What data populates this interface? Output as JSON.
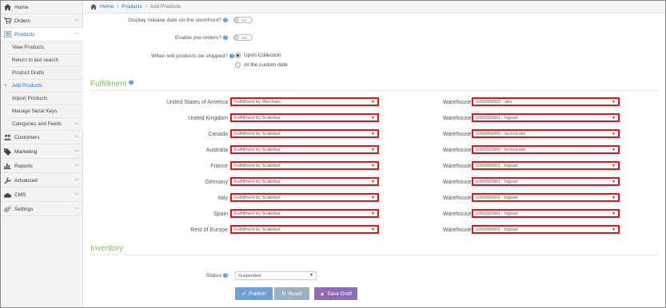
{
  "sidebar": {
    "items": [
      {
        "label": "Home",
        "icon": "home-icon"
      },
      {
        "label": "Orders",
        "icon": "cart-icon"
      },
      {
        "label": "Products",
        "icon": "list-icon"
      },
      {
        "label": "Customers",
        "icon": "users-icon"
      },
      {
        "label": "Marketing",
        "icon": "tag-icon"
      },
      {
        "label": "Reports",
        "icon": "bar-chart-icon"
      },
      {
        "label": "Advanced",
        "icon": "wrench-icon"
      },
      {
        "label": "CMS",
        "icon": "cloud-icon"
      },
      {
        "label": "Settings",
        "icon": "gears-icon"
      }
    ],
    "products_sub": [
      "View Products",
      "Return to last search",
      "Product Drafts",
      "Add Products",
      "Import Products",
      "Manage Serial Keys",
      "Categories and Feeds"
    ]
  },
  "breadcrumb": {
    "home": "Home",
    "products": "Products",
    "current": "Add Products"
  },
  "form": {
    "release_date_label": "Display release date on the storefront?",
    "release_toggle": "NO",
    "preorders_label": "Enable pre-orders?",
    "preorders_toggle": "NO",
    "shipped_label": "When will products be shipped?",
    "ship_opt1": "Upon Collection",
    "ship_opt2": "At the custom date"
  },
  "fulfillment": {
    "title": "Fulfillment",
    "warehouse_label": "Warehouse",
    "rows": [
      {
        "country": "United States of America",
        "method": "Fulfillment by Merchant",
        "warehouse": "1000000003 - sba"
      },
      {
        "country": "United Kingdom",
        "method": "Fulfillment by Scalefast",
        "warehouse": "1000000001 - logvad"
      },
      {
        "country": "Canada",
        "method": "Fulfillment by Scalefast",
        "warehouse": "1000000000 - technicolor"
      },
      {
        "country": "Australia",
        "method": "Fulfillment by Scalefast",
        "warehouse": "1000000000 - technicolor"
      },
      {
        "country": "France",
        "method": "Fulfillment by Scalefast",
        "warehouse": "1000000001 - logvad"
      },
      {
        "country": "Germany",
        "method": "Fulfillment by Scalefast",
        "warehouse": "1000000001 - logvad"
      },
      {
        "country": "Italy",
        "method": "Fulfillment by Scalefast",
        "warehouse": "1000000001 - logvad"
      },
      {
        "country": "Spain",
        "method": "Fulfillment by Scalefast",
        "warehouse": "1000000001 - logvad"
      },
      {
        "country": "Rest of Europe",
        "method": "Fulfillment by Scalefast",
        "warehouse": "1000000001 - logvad"
      }
    ]
  },
  "inventory": {
    "title": "Inventory",
    "status_label": "Status",
    "status_value": "Suspended"
  },
  "actions": {
    "publish": "Publish",
    "reset": "Reset",
    "save_draft": "Save Draft"
  },
  "colors": {
    "accent": "#1b6ec2",
    "section": "#7dbb56",
    "highlight": "#e01414",
    "publish": "#6ea0d6",
    "reset": "#9fb0bd",
    "draft": "#8d6cb3"
  }
}
